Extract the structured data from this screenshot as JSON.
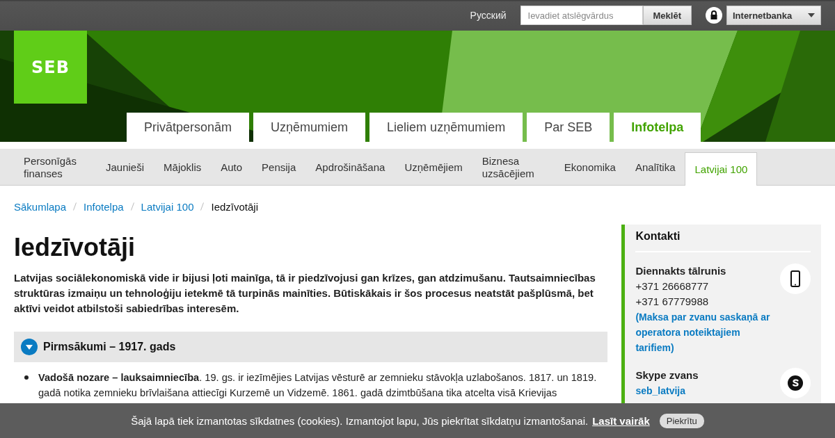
{
  "top_bar": {
    "language": "Русский",
    "search": {
      "placeholder": "Ievadiet atslēgvārdus",
      "button": "Meklēt"
    },
    "internetbank": "Internetbanka"
  },
  "logo": "SEB",
  "main_tabs": [
    {
      "label": "Privātpersonām",
      "selected": false
    },
    {
      "label": "Uzņēmumiem",
      "selected": false
    },
    {
      "label": "Lieliem uzņēmumiem",
      "selected": false
    },
    {
      "label": "Par SEB",
      "selected": false
    },
    {
      "label": "Infotelpa",
      "selected": true
    }
  ],
  "sub_nav": [
    {
      "label": "Personīgās finanses",
      "selected": false
    },
    {
      "label": "Jaunieši",
      "selected": false
    },
    {
      "label": "Mājoklis",
      "selected": false
    },
    {
      "label": "Auto",
      "selected": false
    },
    {
      "label": "Pensija",
      "selected": false
    },
    {
      "label": "Apdrošināšana",
      "selected": false
    },
    {
      "label": "Uzņēmējiem",
      "selected": false
    },
    {
      "label": "Biznesa uzsācējiem",
      "selected": false
    },
    {
      "label": "Ekonomika",
      "selected": false
    },
    {
      "label": "Analītika",
      "selected": false
    },
    {
      "label": "Latvijai 100",
      "selected": true
    }
  ],
  "breadcrumb": [
    "Sākumlapa",
    "Infotelpa",
    "Latvijai 100",
    "Iedzīvotāji"
  ],
  "article": {
    "title": "Iedzīvotāji",
    "lead": "Latvijas sociālekonomiskā vide ir bijusi ļoti mainīga, tā ir piedzīvojusi gan krīzes, gan atdzimušanu. Tautsaimniecības struktūras izmaiņu un tehnoloģiju ietekmē tā turpinās mainīties. Būtiskākais ir šos procesus neatstāt pašplūsmā, bet aktīvi veidot atbilstoši sabiedrības interesēm.",
    "sections": [
      {
        "title": "Pirmsākumi – 1917. gads",
        "expanded": true,
        "items": [
          "**Vadošā nozare – lauksaimniecība**. 19. gs. ir iezīmējies Latvijas vēsturē ar zemnieku stāvokļa uzlabošanos. 1817. un 1819. gadā notika zemnieku brīvlaišana attiecīgi Kurzemē un Vidzemē. 1861. gadā dzimtbūšana tika atcelta visā Krievijas"
        ]
      }
    ]
  },
  "contacts": {
    "title": "Kontakti",
    "blocks": [
      {
        "kind": "phone",
        "title": "Diennakts tālrunis",
        "lines": [
          "+371 26668777",
          "+371 67779988"
        ],
        "link": "(Maksa par zvanu saskaņā ar operatora noteiktajiem tarifiem)"
      },
      {
        "kind": "skype",
        "title": "Skype zvans",
        "link": "seb_latvija"
      }
    ]
  },
  "cookie_bar": {
    "text": "Šajā lapā tiek izmantotas sīkdatnes (cookies). Izmantojot lapu, Jūs piekrītat sīkdatņu izmantošanai.",
    "link": "Lasīt vairāk",
    "button": "Piekrītu"
  }
}
